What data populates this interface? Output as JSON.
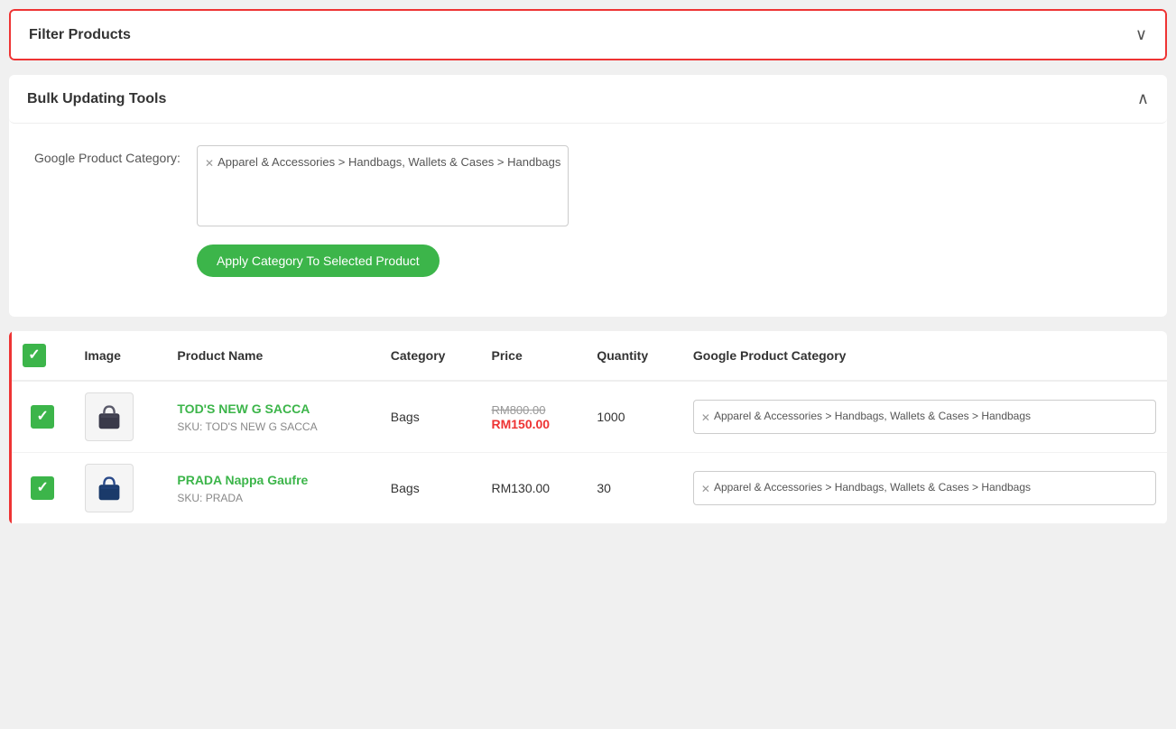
{
  "filterSection": {
    "title": "Filter Products",
    "chevron": "∨"
  },
  "bulkSection": {
    "title": "Bulk Updating Tools",
    "chevron": "∧",
    "formLabel": "Google Product Category:",
    "categoryTag": "Apparel & Accessories > Handbags, Wallets & Cases > Handbags",
    "applyButtonLabel": "Apply Category To Selected Product"
  },
  "productsTable": {
    "columns": [
      "",
      "Image",
      "Product Name",
      "Category",
      "Price",
      "Quantity",
      "Google Product Category"
    ],
    "rows": [
      {
        "checked": true,
        "imageAlt": "TOD's bag",
        "productName": "TOD'S NEW G SACCA",
        "sku": "SKU: TOD'S NEW G SACCA",
        "category": "Bags",
        "priceOriginal": "RM800.00",
        "priceDiscounted": "RM150.00",
        "quantity": "1000",
        "googleCategory": "Apparel & Accessories > Handbags, Wallets & Cases > Handbags",
        "bagColor1": "#3a3a4a",
        "bagColor2": "#5a5a6a"
      },
      {
        "checked": true,
        "imageAlt": "PRADA bag",
        "productName": "PRADA Nappa Gaufre",
        "sku": "SKU: PRADA",
        "category": "Bags",
        "priceOriginal": "",
        "priceDiscounted": "",
        "priceNormal": "RM130.00",
        "quantity": "30",
        "googleCategory": "Apparel & Accessories > Handbags, Wallets & Cases > Handbags",
        "bagColor1": "#1a3a6a",
        "bagColor2": "#2a4a8a"
      }
    ]
  }
}
